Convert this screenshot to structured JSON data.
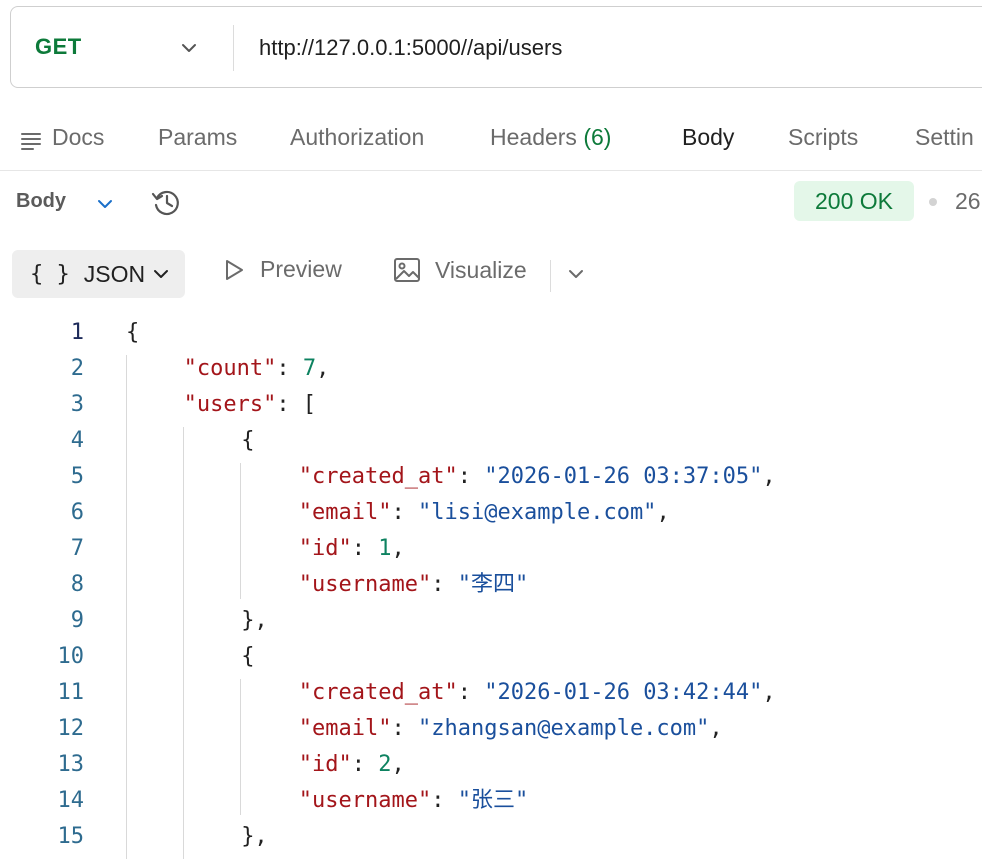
{
  "request": {
    "method": "GET",
    "url": "http://127.0.0.1:5000//api/users"
  },
  "tabs": [
    {
      "label": "Docs"
    },
    {
      "label": "Params"
    },
    {
      "label": "Authorization"
    },
    {
      "label": "Headers",
      "count": "(6)"
    },
    {
      "label": "Body"
    },
    {
      "label": "Scripts"
    },
    {
      "label": "Settin"
    }
  ],
  "response": {
    "body_label": "Body",
    "status": "200 OK",
    "time_partial": "26",
    "format": "JSON",
    "format_braces": "{ }",
    "preview_label": "Preview",
    "visualize_label": "Visualize"
  },
  "code_lines": [
    {
      "n": "1",
      "indent": 0,
      "parts": [
        [
          "p",
          "{"
        ]
      ]
    },
    {
      "n": "2",
      "indent": 1,
      "parts": [
        [
          "k",
          "\"count\""
        ],
        [
          "p",
          ": "
        ],
        [
          "n",
          "7"
        ],
        [
          "p",
          ","
        ]
      ]
    },
    {
      "n": "3",
      "indent": 1,
      "parts": [
        [
          "k",
          "\"users\""
        ],
        [
          "p",
          ": ["
        ]
      ]
    },
    {
      "n": "4",
      "indent": 2,
      "parts": [
        [
          "p",
          "{"
        ]
      ]
    },
    {
      "n": "5",
      "indent": 3,
      "parts": [
        [
          "k",
          "\"created_at\""
        ],
        [
          "p",
          ": "
        ],
        [
          "s",
          "\"2026-01-26 03:37:05\""
        ],
        [
          "p",
          ","
        ]
      ]
    },
    {
      "n": "6",
      "indent": 3,
      "parts": [
        [
          "k",
          "\"email\""
        ],
        [
          "p",
          ": "
        ],
        [
          "s",
          "\"lisi@example.com\""
        ],
        [
          "p",
          ","
        ]
      ]
    },
    {
      "n": "7",
      "indent": 3,
      "parts": [
        [
          "k",
          "\"id\""
        ],
        [
          "p",
          ": "
        ],
        [
          "n",
          "1"
        ],
        [
          "p",
          ","
        ]
      ]
    },
    {
      "n": "8",
      "indent": 3,
      "parts": [
        [
          "k",
          "\"username\""
        ],
        [
          "p",
          ": "
        ],
        [
          "s",
          "\"李四\""
        ]
      ]
    },
    {
      "n": "9",
      "indent": 2,
      "parts": [
        [
          "p",
          "},"
        ]
      ]
    },
    {
      "n": "10",
      "indent": 2,
      "parts": [
        [
          "p",
          "{"
        ]
      ]
    },
    {
      "n": "11",
      "indent": 3,
      "parts": [
        [
          "k",
          "\"created_at\""
        ],
        [
          "p",
          ": "
        ],
        [
          "s",
          "\"2026-01-26 03:42:44\""
        ],
        [
          "p",
          ","
        ]
      ]
    },
    {
      "n": "12",
      "indent": 3,
      "parts": [
        [
          "k",
          "\"email\""
        ],
        [
          "p",
          ": "
        ],
        [
          "s",
          "\"zhangsan@example.com\""
        ],
        [
          "p",
          ","
        ]
      ]
    },
    {
      "n": "13",
      "indent": 3,
      "parts": [
        [
          "k",
          "\"id\""
        ],
        [
          "p",
          ": "
        ],
        [
          "n",
          "2"
        ],
        [
          "p",
          ","
        ]
      ]
    },
    {
      "n": "14",
      "indent": 3,
      "parts": [
        [
          "k",
          "\"username\""
        ],
        [
          "p",
          ": "
        ],
        [
          "s",
          "\"张三\""
        ]
      ]
    },
    {
      "n": "15",
      "indent": 2,
      "parts": [
        [
          "p",
          "},"
        ]
      ]
    }
  ],
  "colors": {
    "method": "#0d7a3a",
    "key": "#a3151a",
    "string": "#1a4f9c",
    "number": "#0d8260",
    "status_bg": "#e4f7e9"
  }
}
